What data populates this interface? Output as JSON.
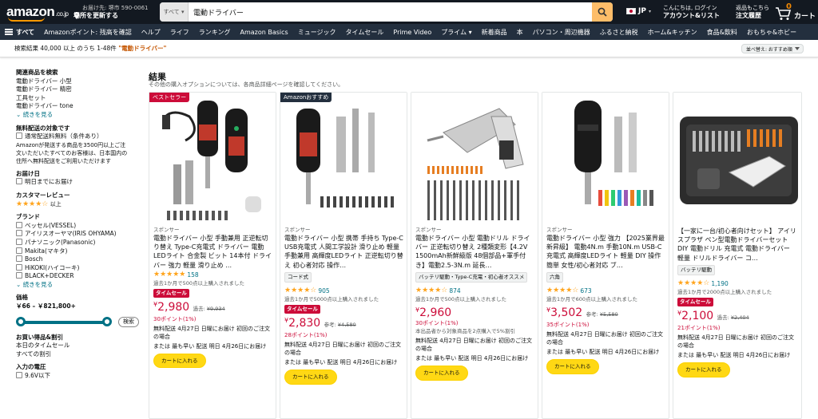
{
  "header": {
    "logo_text": "amazon",
    "logo_suffix": ".co.jp",
    "deliver_line1": "お届け先: 堺市 590-0061",
    "deliver_line2": "場所を更新する",
    "search_category": "すべて",
    "search_value": "電動ドライバー",
    "language": "JP",
    "account_line1": "こんにちは, ログイン",
    "account_line2": "アカウント&リスト",
    "orders_line1": "返品もこちら",
    "orders_line2": "注文履歴",
    "cart_count": "0",
    "cart_label": "カート"
  },
  "nav": {
    "all_label": "すべて",
    "items": [
      "Amazonポイント: 残高を確認",
      "ヘルプ",
      "ライフ",
      "ランキング",
      "Amazon Basics",
      "ミュージック",
      "タイムセール",
      "Prime Video",
      "プライム ▾",
      "新着商品",
      "本",
      "パソコン・周辺機器",
      "ふるさと納税",
      "ホーム&キッチン",
      "食品&飲料",
      "おもちゃ&ホビー"
    ]
  },
  "results_bar": {
    "count_text": "検索結果 40,000 以上 のうち 1-48件",
    "query": "\"電動ドライバー\"",
    "sort_label": "並べ替え: おすすめ順"
  },
  "sidebar": {
    "related_heading": "関連商品を検索",
    "related_items": [
      "電動ドライバー 小型",
      "電動ドライバー 精密",
      "工具セット",
      "電動ドライバー tone"
    ],
    "see_more": "続きを見る",
    "free_ship_heading": "無料配送の対象です",
    "free_ship_option": "通常配送料無料（条件あり）",
    "free_ship_note": "Amazonが発送する商品を3500円以上ご注文いただいたすべてのお客様は、日本国内の住所へ無料配送をご利用いただけます",
    "delivery_heading": "お届け日",
    "delivery_option": "明日までにお届け",
    "review_heading": "カスタマーレビュー",
    "review_stars": "★★★★☆",
    "review_suffix": "以上",
    "brand_heading": "ブランド",
    "brands": [
      "ベッセル(VESSEL)",
      "アイリスオーヤマ(IRIS OHYAMA)",
      "パナソニック(Panasonic)",
      "Makita(マキタ)",
      "Bosch",
      "HiKOKI(ハイコーキ)",
      "BLACK+DECKER"
    ],
    "brand_see_more": "続きを見る",
    "price_heading": "価格",
    "price_range": "￥66 – ￥821,800+",
    "price_min_fraction": 0,
    "price_max_fraction": 1,
    "price_go": "検索",
    "deals_heading": "お買い得品&割引",
    "deals_items": [
      "本日のタイムセール",
      "すべての割引"
    ],
    "voltage_heading": "入力の電圧",
    "voltage_option": "9.6V以下"
  },
  "results": {
    "title": "結果",
    "subtitle": "その他の購入オプションについては、各商品詳細ページを確認してください。"
  },
  "products": [
    {
      "badge": "ベストセラー",
      "sponsored": "スポンサー",
      "title": "電動ドライバー 小型 手動兼用 正逆転切り替え Type-C充電式 ドライバー 電動 LEDライト 合金製 ビット 14本付 ドライバー 強力 軽量 滑り止め …",
      "chip": "",
      "stars": "★★★★★",
      "rating_count": "158",
      "bought": "過去1か月で500点以上購入されました",
      "deal": "タイムセール",
      "price": "2,980",
      "was_label": "過去:",
      "was_price": "¥9,934",
      "points": "30ポイント(1%)",
      "ship_lines": [
        "無料配送 4月27日 日曜にお届け 初回のご注文の場合",
        "または 最も早い 配送 明日 4月26日にお届け"
      ],
      "add_to_cart": "カートに入れる"
    },
    {
      "badge": "Amazonおすすめ",
      "sponsored": "スポンサー",
      "title": "電動ドライバー 小型 携帯 手持ち Type-C USB充電式 人間工学設計 滑り止め 軽量 手動兼用 高輝度LEDライト 正逆転切り替え 初心者対応 操作…",
      "chip": "コード式",
      "stars": "★★★★☆",
      "rating_count": "905",
      "bought": "過去1か月で5000点以上購入されました",
      "deal": "タイムセール",
      "price": "2,830",
      "was_label": "参考:",
      "was_price": "¥4,580",
      "points": "28ポイント(1%)",
      "ship_lines": [
        "無料配送 4月27日 日曜にお届け 初回のご注文の場合",
        "または 最も早い 配送 明日 4月26日にお届け"
      ],
      "add_to_cart": "カートに入れる"
    },
    {
      "badge": "",
      "sponsored": "スポンサー",
      "title": "電動ドライバー 小型 電動ドリル ドライバー 正逆転切り替え 2種類変形【4.2V 1500mAh新鮮級版 48個部品+軍手付き】電動2.5-3N.m 延長…",
      "chip": "バッテリ駆動・Type-C充電・初心者オススメ",
      "stars": "★★★★☆",
      "rating_count": "874",
      "bought": "過去1か月で500点以上購入されました",
      "deal": "",
      "price": "2,960",
      "was_label": "",
      "was_price": "",
      "points": "30ポイント(1%)",
      "extra": "本出品者から対象商品を2点購入で5%割引",
      "ship_lines": [
        "無料配送 4月27日 日曜にお届け 初回のご注文の場合",
        "または 最も早い 配送 明日 4月26日にお届け"
      ],
      "add_to_cart": "カートに入れる"
    },
    {
      "badge": "",
      "sponsored": "スポンサー",
      "title": "電動ドライバー 小型 強力 【2025業界最新昇級】 電動4N.m 手動10N.m USB-C充電式 高輝度LEDライト 軽量 DIY 操作簡単 女性/初心者対応 ブ…",
      "chip": "六角",
      "stars": "★★★★☆",
      "rating_count": "673",
      "bought": "過去1か月で600点以上購入されました",
      "deal": "",
      "price": "3,502",
      "was_label": "参考:",
      "was_price": "¥5,580",
      "points": "35ポイント(1%)",
      "ship_lines": [
        "無料配送 4月27日 日曜にお届け 初回のご注文の場合",
        "または 最も早い 配送 明日 4月26日にお届け"
      ],
      "add_to_cart": "カートに入れる"
    },
    {
      "badge": "",
      "sponsored": "",
      "title": "【一家に一台/初心者向けセット】 アイリスプラザ ペン型電動ドライバーセット DIY 電動ドリル 充電式 電動ドライバー 軽量 ドリルドライバー コ…",
      "chip": "バッテリ駆動",
      "stars": "★★★★☆",
      "rating_count": "1,190",
      "bought": "過去1か月で2000点以上購入されました",
      "deal": "タイムセール",
      "price": "2,100",
      "was_label": "過去:",
      "was_price": "¥2,404",
      "points": "21ポイント(1%)",
      "ship_lines": [
        "無料配送 4月27日 日曜にお届け 初回のご注文の場合",
        "または 最も早い 配送 明日 4月26日にお届け"
      ],
      "add_to_cart": "カートに入れる"
    }
  ],
  "colors": {
    "header_bg": "#131921",
    "nav_bg": "#232f3e",
    "accent": "#ff9900",
    "deal_red": "#cc0c39",
    "link": "#007185",
    "cart_button": "#ffd814"
  }
}
